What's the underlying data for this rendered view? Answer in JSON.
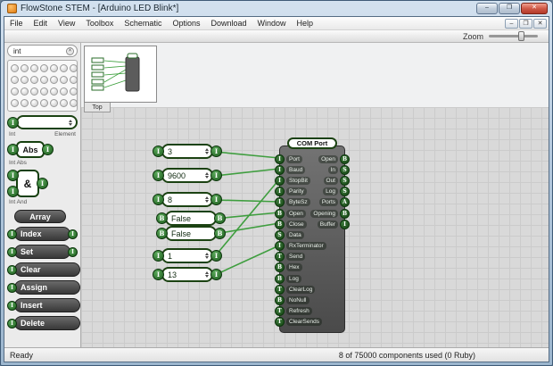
{
  "window": {
    "title": "FlowStone STEM - [Arduino LED Blink*]"
  },
  "icons": {
    "minimize": "–",
    "restore": "❐",
    "close": "✕",
    "clear": "✕"
  },
  "menu": {
    "items": [
      "File",
      "Edit",
      "View",
      "Toolbox",
      "Schematic",
      "Options",
      "Download",
      "Window",
      "Help"
    ]
  },
  "toolbar": {
    "zoom_label": "Zoom"
  },
  "sidebar": {
    "search_value": "int",
    "palette_count": 28,
    "preview": {
      "type": "I"
    },
    "captions": {
      "left": "Int",
      "right": "Element"
    },
    "abs": {
      "label": "Abs",
      "caption": "Int Abs",
      "in_type": "I",
      "out_type": "I"
    },
    "and": {
      "label": "&",
      "caption": "Int And",
      "in_type": "I",
      "out_type": "I"
    },
    "array": {
      "title": "Array",
      "items": [
        {
          "label": "Index",
          "in": "I",
          "out": "I"
        },
        {
          "label": "Set",
          "in": "I",
          "out": "I"
        },
        {
          "label": "Clear",
          "in": "I"
        },
        {
          "label": "Assign",
          "in": "I"
        },
        {
          "label": "Insert",
          "in": "I"
        },
        {
          "label": "Delete",
          "in": "I"
        }
      ]
    }
  },
  "canvas": {
    "navigator_tab": "Top",
    "values": [
      {
        "value": "3",
        "type": "I"
      },
      {
        "value": "9600",
        "type": "I"
      },
      {
        "value": "8",
        "type": "I"
      },
      {
        "value": "False",
        "type": "B"
      },
      {
        "value": "False",
        "type": "B"
      },
      {
        "value": "1",
        "type": "I"
      },
      {
        "value": "13",
        "type": "I"
      }
    ],
    "module": {
      "title": "COM Port",
      "inputs": [
        {
          "label": "Port",
          "type": "I"
        },
        {
          "label": "Baud",
          "type": "I"
        },
        {
          "label": "StopBit",
          "type": "I"
        },
        {
          "label": "Parity",
          "type": "I"
        },
        {
          "label": "ByteSz",
          "type": "I"
        },
        {
          "label": "Open",
          "type": "B"
        },
        {
          "label": "Close",
          "type": "B"
        },
        {
          "label": "Data",
          "type": "S"
        },
        {
          "label": "RxTerminator",
          "type": "I"
        },
        {
          "label": "Send",
          "type": "T"
        },
        {
          "label": "Hex",
          "type": "B"
        },
        {
          "label": "Log",
          "type": "B"
        },
        {
          "label": "ClearLog",
          "type": "T"
        },
        {
          "label": "NoNull",
          "type": "B"
        },
        {
          "label": "Refresh",
          "type": "T"
        },
        {
          "label": "ClearSends",
          "type": "T"
        }
      ],
      "outputs": [
        {
          "label": "Open",
          "type": "B"
        },
        {
          "label": "In",
          "type": "S"
        },
        {
          "label": "Out",
          "type": "S"
        },
        {
          "label": "Log",
          "type": "S"
        },
        {
          "label": "Ports",
          "type": "A"
        },
        {
          "label": "Opening",
          "type": "B"
        },
        {
          "label": "Buffer",
          "type": "I"
        }
      ]
    }
  },
  "status": {
    "left": "Ready",
    "right": "8 of 75000 components used (0 Ruby)"
  }
}
